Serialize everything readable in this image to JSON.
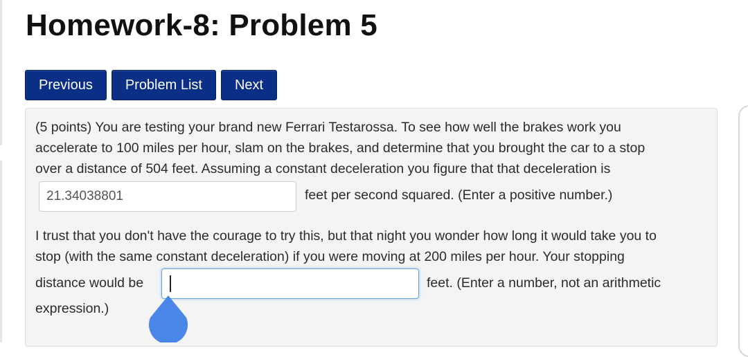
{
  "page": {
    "title": "Homework-8: Problem 5"
  },
  "nav": {
    "previous": "Previous",
    "problem_list": "Problem List",
    "next": "Next"
  },
  "problem": {
    "p1_line1": "(5 points) You are testing your brand new Ferrari Testarossa. To see how well the brakes work you",
    "p1_line2": "accelerate to 100 miles per hour, slam on the brakes, and determine that you brought the car to a stop",
    "p1_line3": "over a distance of 504 feet. Assuming a constant deceleration you figure that that deceleration is",
    "answer1_value": "21.34038801",
    "after_answer1": "feet per second squared. (Enter a positive number.)",
    "p2_line1": "I trust that you don't have the courage to try this, but that night you wonder how long it would take you to",
    "p2_line2": "stop (with the same constant deceleration) if you were moving at 200 miles per hour. Your stopping",
    "before_answer2": "distance would be",
    "answer2_value": "",
    "after_answer2": "feet. (Enter a number, not an arithmetic",
    "p2_line4": "expression.)"
  },
  "colors": {
    "nav_button": "#0b2f86",
    "cursor_handle": "#4a86e8"
  }
}
